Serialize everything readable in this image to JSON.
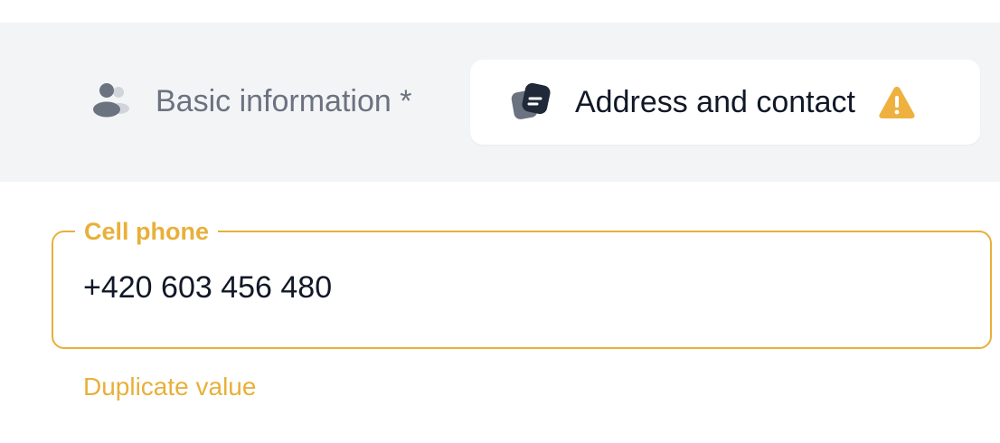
{
  "tabs": [
    {
      "label": "Basic information *",
      "icon": "users-icon",
      "active": false
    },
    {
      "label": "Address and contact",
      "icon": "contact-card-icon",
      "status_icon": "warning-icon",
      "active": true
    }
  ],
  "cell_phone": {
    "label": "Cell phone",
    "value": "+420 603 456 480",
    "error": "Duplicate value"
  },
  "colors": {
    "warning": "#e8b03a",
    "tab_bar_bg": "#f3f4f6",
    "active_tab_text": "#111827",
    "inactive_tab_text": "#6b7280"
  }
}
